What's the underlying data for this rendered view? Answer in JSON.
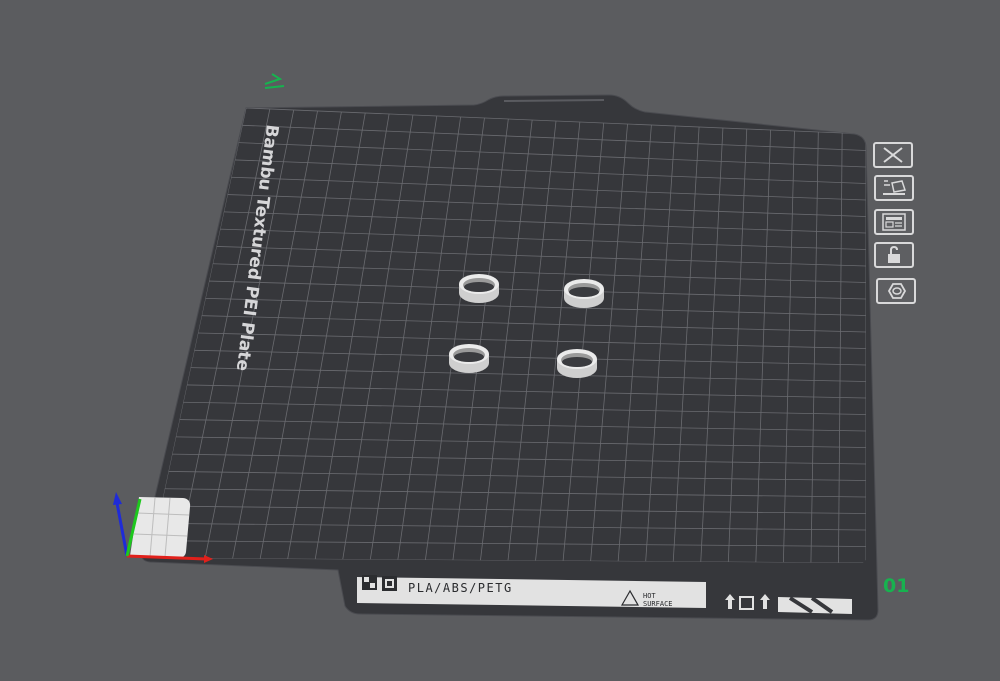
{
  "plate": {
    "name": "Bambu Textured PEI Plate",
    "materials": "PLA/ABS/PETG",
    "hot_warning_line1": "HOT",
    "hot_warning_line2": "SURFACE",
    "plate_number": "01"
  },
  "toolbar": {
    "buttons": [
      {
        "name": "delete-plate-button",
        "icon": "close-icon"
      },
      {
        "name": "arrange-button",
        "icon": "arrange-icon"
      },
      {
        "name": "plate-settings-button",
        "icon": "layout-icon"
      },
      {
        "name": "lock-plate-button",
        "icon": "lock-icon"
      },
      {
        "name": "plate-type-button",
        "icon": "nut-icon"
      }
    ]
  },
  "colors": {
    "background": "#5b5c5f",
    "plate": "#36373b",
    "grid": "#6a6b70",
    "object": "#e3e3e3",
    "plate_number": "#17b24f",
    "axis_x": "#e0201b",
    "axis_y": "#1ec81e",
    "axis_z": "#1f2bd8"
  }
}
